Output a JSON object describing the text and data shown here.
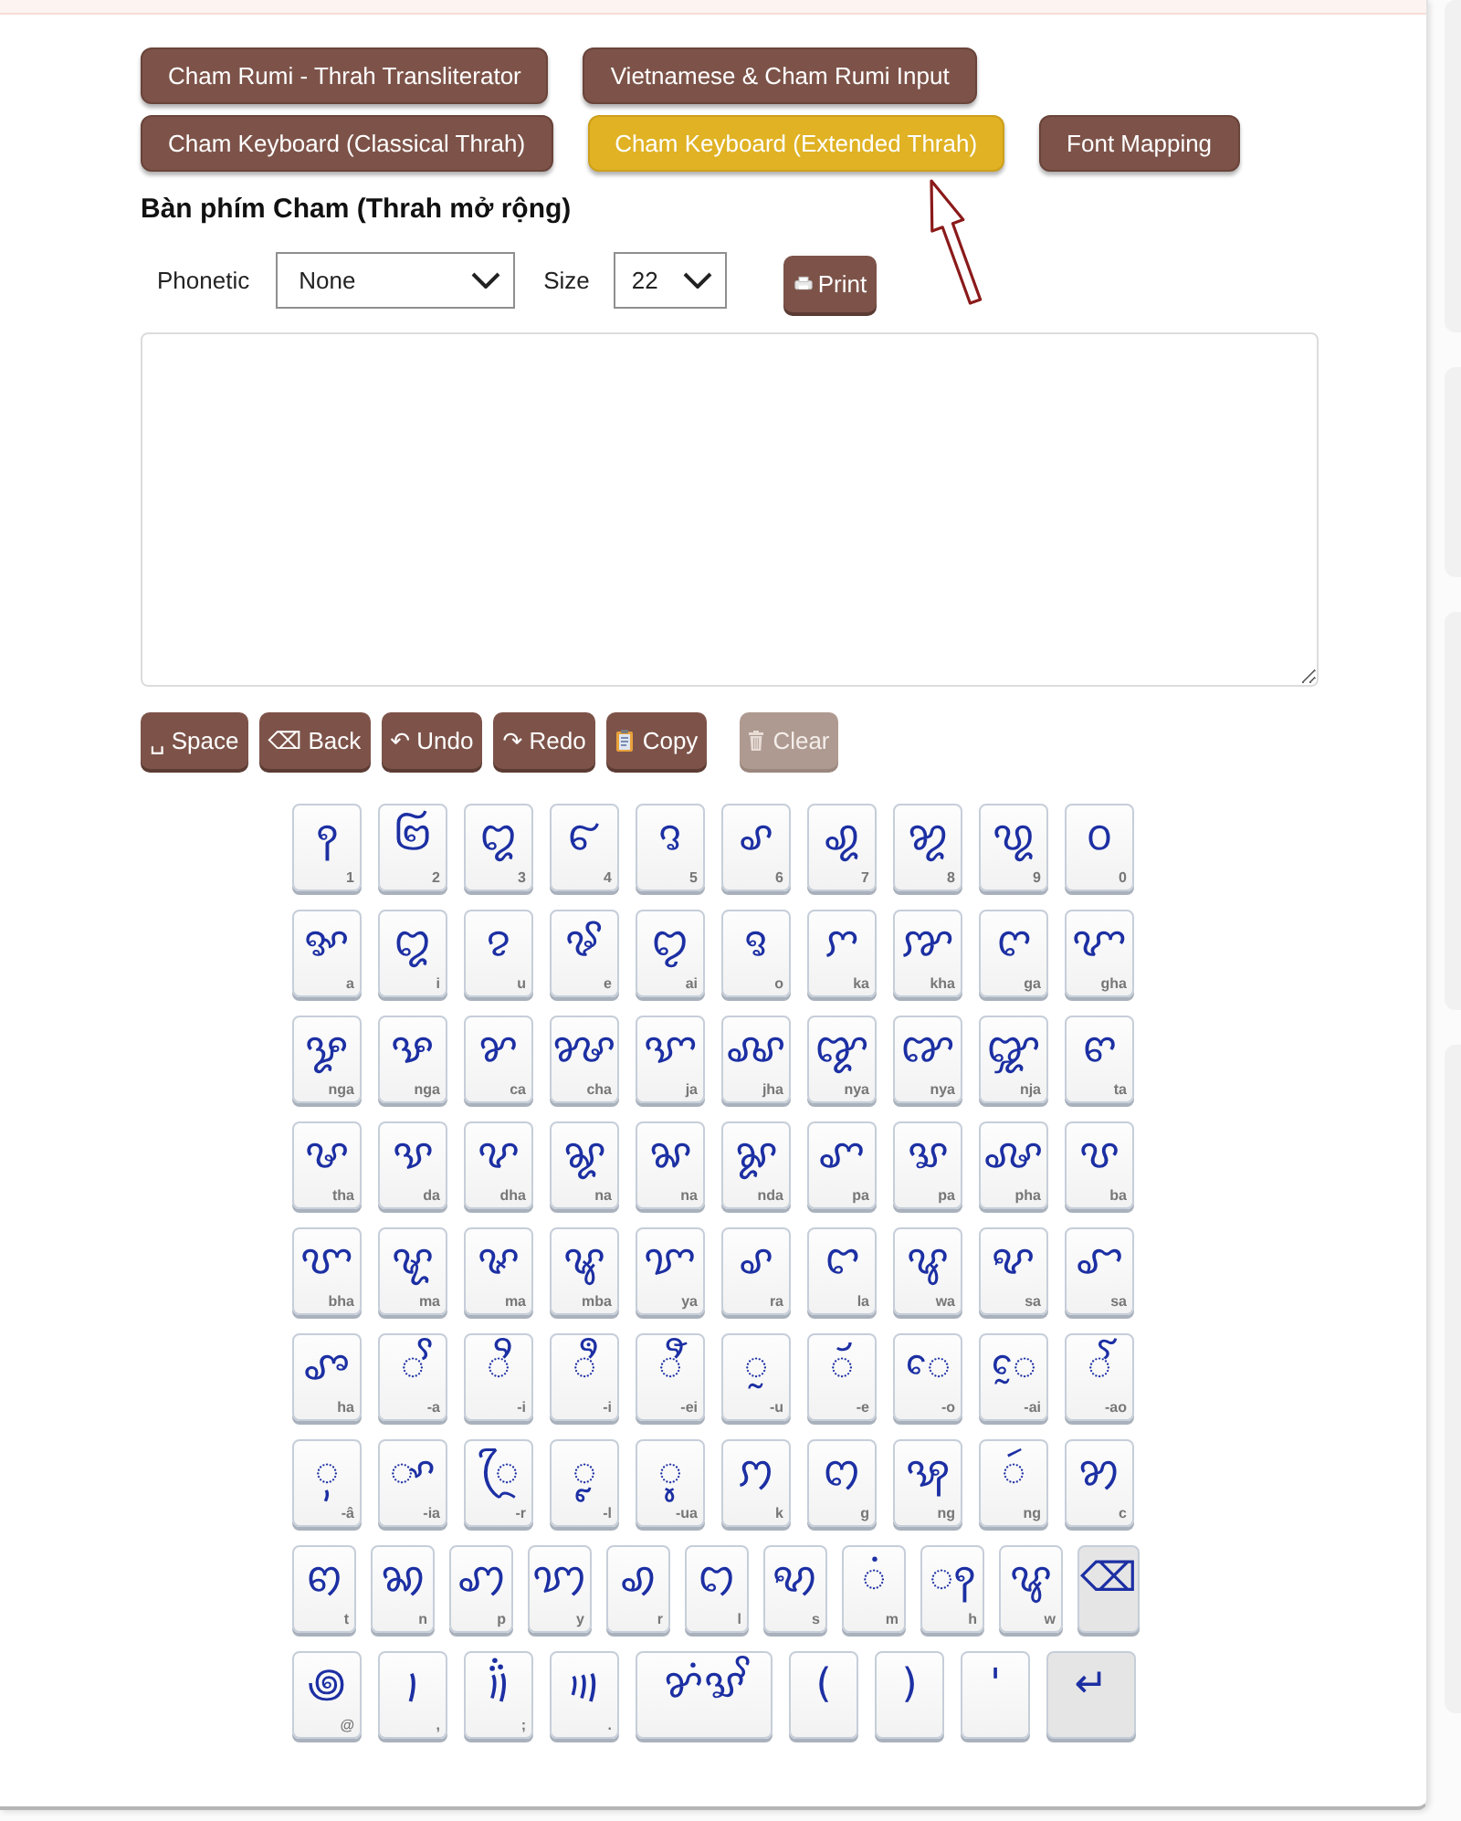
{
  "nav_buttons": [
    {
      "label": "Cham Rumi - Thrah Transliterator",
      "selected": false
    },
    {
      "label": "Vietnamese & Cham Rumi Input",
      "selected": false
    },
    {
      "label": "Cham Keyboard (Classical Thrah)",
      "selected": false
    },
    {
      "label": "Cham Keyboard (Extended Thrah)",
      "selected": true
    },
    {
      "label": "Font Mapping",
      "selected": false
    }
  ],
  "heading": "Bàn phím Cham (Thrah mở rộng)",
  "phonetic": {
    "label": "Phonetic",
    "value": "None"
  },
  "size": {
    "label": "Size",
    "value": "22"
  },
  "print_button": "Print",
  "actions": [
    {
      "label": "␣ Space",
      "kind": "text",
      "disabled": false
    },
    {
      "label": "⌫ Back",
      "kind": "text",
      "disabled": false
    },
    {
      "label": "↶ Undo",
      "kind": "text",
      "disabled": false
    },
    {
      "label": "↷ Redo",
      "kind": "text",
      "disabled": false
    },
    {
      "label": "Copy",
      "kind": "copy",
      "disabled": false
    },
    {
      "label": "Clear",
      "kind": "clear",
      "disabled": true
    }
  ],
  "keyboard": [
    [
      {
        "glyph": "꩑",
        "label": "1",
        "kind": "char"
      },
      {
        "glyph": "꩒",
        "label": "2",
        "kind": "char"
      },
      {
        "glyph": "꩓",
        "label": "3",
        "kind": "char"
      },
      {
        "glyph": "꩔",
        "label": "4",
        "kind": "char"
      },
      {
        "glyph": "꩕",
        "label": "5",
        "kind": "char"
      },
      {
        "glyph": "꩖",
        "label": "6",
        "kind": "char"
      },
      {
        "glyph": "꩗",
        "label": "7",
        "kind": "char"
      },
      {
        "glyph": "꩘",
        "label": "8",
        "kind": "char"
      },
      {
        "glyph": "꩙",
        "label": "9",
        "kind": "char"
      },
      {
        "glyph": "꩐",
        "label": "0",
        "kind": "char"
      }
    ],
    [
      {
        "glyph": "ꨀ",
        "label": "a",
        "kind": "char"
      },
      {
        "glyph": "ꨁ",
        "label": "i",
        "kind": "char"
      },
      {
        "glyph": "ꨂ",
        "label": "u",
        "kind": "char"
      },
      {
        "glyph": "ꨃ",
        "label": "e",
        "kind": "char"
      },
      {
        "glyph": "ꨄ",
        "label": "ai",
        "kind": "char"
      },
      {
        "glyph": "ꨅ",
        "label": "o",
        "kind": "char"
      },
      {
        "glyph": "ꨆ",
        "label": "ka",
        "kind": "char"
      },
      {
        "glyph": "ꨇ",
        "label": "kha",
        "kind": "char"
      },
      {
        "glyph": "ꨈ",
        "label": "ga",
        "kind": "char"
      },
      {
        "glyph": "ꨉ",
        "label": "gha",
        "kind": "char"
      }
    ],
    [
      {
        "glyph": "ꨋ",
        "label": "nga",
        "kind": "char"
      },
      {
        "glyph": "ꨊ",
        "label": "nga",
        "kind": "char"
      },
      {
        "glyph": "ꨌ",
        "label": "ca",
        "kind": "char"
      },
      {
        "glyph": "ꨍ",
        "label": "cha",
        "kind": "char"
      },
      {
        "glyph": "ꨎ",
        "label": "ja",
        "kind": "char"
      },
      {
        "glyph": "ꨏ",
        "label": "jha",
        "kind": "char"
      },
      {
        "glyph": "ꨑ",
        "label": "nya",
        "kind": "char"
      },
      {
        "glyph": "ꨐ",
        "label": "nya",
        "kind": "char"
      },
      {
        "glyph": "ꨒ",
        "label": "nja",
        "kind": "char"
      },
      {
        "glyph": "ꨓ",
        "label": "ta",
        "kind": "char"
      }
    ],
    [
      {
        "glyph": "ꨔ",
        "label": "tha",
        "kind": "char"
      },
      {
        "glyph": "ꨕ",
        "label": "da",
        "kind": "char"
      },
      {
        "glyph": "ꨖ",
        "label": "dha",
        "kind": "char"
      },
      {
        "glyph": "ꨘ",
        "label": "na",
        "kind": "char"
      },
      {
        "glyph": "ꨗ",
        "label": "na",
        "kind": "char"
      },
      {
        "glyph": "ꨙ",
        "label": "nda",
        "kind": "char"
      },
      {
        "glyph": "ꨚ",
        "label": "pa",
        "kind": "char"
      },
      {
        "glyph": "ꨛ",
        "label": "pa",
        "kind": "char"
      },
      {
        "glyph": "ꨜ",
        "label": "pha",
        "kind": "char"
      },
      {
        "glyph": "ꨝ",
        "label": "ba",
        "kind": "char"
      }
    ],
    [
      {
        "glyph": "ꨞ",
        "label": "bha",
        "kind": "char"
      },
      {
        "glyph": "ꨠ",
        "label": "ma",
        "kind": "char"
      },
      {
        "glyph": "ꨟ",
        "label": "ma",
        "kind": "char"
      },
      {
        "glyph": "ꨡ",
        "label": "mba",
        "kind": "char"
      },
      {
        "glyph": "ꨢ",
        "label": "ya",
        "kind": "char"
      },
      {
        "glyph": "ꨣ",
        "label": "ra",
        "kind": "char"
      },
      {
        "glyph": "ꨤ",
        "label": "la",
        "kind": "char"
      },
      {
        "glyph": "ꨥ",
        "label": "wa",
        "kind": "char"
      },
      {
        "glyph": "ꨦ",
        "label": "sa",
        "kind": "char"
      },
      {
        "glyph": "ꨧ",
        "label": "sa",
        "kind": "char"
      }
    ],
    [
      {
        "glyph": "ꨨ",
        "label": "ha",
        "kind": "char"
      },
      {
        "glyph": "◌ꨩ",
        "label": "-a",
        "kind": "char"
      },
      {
        "glyph": "◌ꨪ",
        "label": "-i",
        "kind": "char"
      },
      {
        "glyph": "◌ꨫ",
        "label": "-i",
        "kind": "char"
      },
      {
        "glyph": "◌ꨬ",
        "label": "-ei",
        "kind": "char"
      },
      {
        "glyph": "◌ꨭ",
        "label": "-u",
        "kind": "char"
      },
      {
        "glyph": "◌ꨮ",
        "label": "-e",
        "kind": "char"
      },
      {
        "glyph": "◌ꨯ",
        "label": "-o",
        "kind": "char"
      },
      {
        "glyph": "◌ꨰ",
        "label": "-ai",
        "kind": "char"
      },
      {
        "glyph": "◌ꨱ",
        "label": "-ao",
        "kind": "char"
      }
    ],
    [
      {
        "glyph": "◌ꨲ",
        "label": "-â",
        "kind": "char"
      },
      {
        "glyph": "◌ꨳ",
        "label": "-ia",
        "kind": "char"
      },
      {
        "glyph": "◌ꨴ",
        "label": "-r",
        "kind": "char"
      },
      {
        "glyph": "◌ꨵ",
        "label": "-l",
        "kind": "char"
      },
      {
        "glyph": "◌ꨶ",
        "label": "-ua",
        "kind": "char"
      },
      {
        "glyph": "ꩀ",
        "label": "k",
        "kind": "char"
      },
      {
        "glyph": "ꩁ",
        "label": "g",
        "kind": "char"
      },
      {
        "glyph": "ꩂ",
        "label": "ng",
        "kind": "char"
      },
      {
        "glyph": "◌ꩃ",
        "label": "ng",
        "kind": "char"
      },
      {
        "glyph": "ꩄ",
        "label": "c",
        "kind": "char"
      }
    ],
    [
      {
        "glyph": "ꩅ",
        "label": "t",
        "kind": "char"
      },
      {
        "glyph": "ꩆ",
        "label": "n",
        "kind": "char"
      },
      {
        "glyph": "ꩇ",
        "label": "p",
        "kind": "char"
      },
      {
        "glyph": "ꩈ",
        "label": "y",
        "kind": "char"
      },
      {
        "glyph": "ꩉ",
        "label": "r",
        "kind": "char"
      },
      {
        "glyph": "ꩊ",
        "label": "l",
        "kind": "char"
      },
      {
        "glyph": "ꩋ",
        "label": "s",
        "kind": "char"
      },
      {
        "glyph": "◌ꩌ",
        "label": "m",
        "kind": "char"
      },
      {
        "glyph": "◌ꩍ",
        "label": "h",
        "kind": "char"
      },
      {
        "glyph": "ꨥ",
        "label": "w",
        "kind": "char"
      },
      {
        "glyph": "⌫",
        "kind": "action"
      }
    ],
    [
      {
        "glyph": "꩜",
        "label": "@",
        "kind": "char"
      },
      {
        "glyph": "꩝",
        "label": ",",
        "kind": "char"
      },
      {
        "glyph": "꩞",
        "label": ";",
        "kind": "char"
      },
      {
        "glyph": "꩟",
        "label": ".",
        "kind": "char"
      },
      {
        "glyph": "ꨌꩌꨛꨩ",
        "kind": "wide"
      },
      {
        "glyph": "(",
        "kind": "char"
      },
      {
        "glyph": ")",
        "kind": "char"
      },
      {
        "glyph": "'",
        "kind": "char"
      },
      {
        "glyph": "↵",
        "kind": "action"
      }
    ]
  ]
}
